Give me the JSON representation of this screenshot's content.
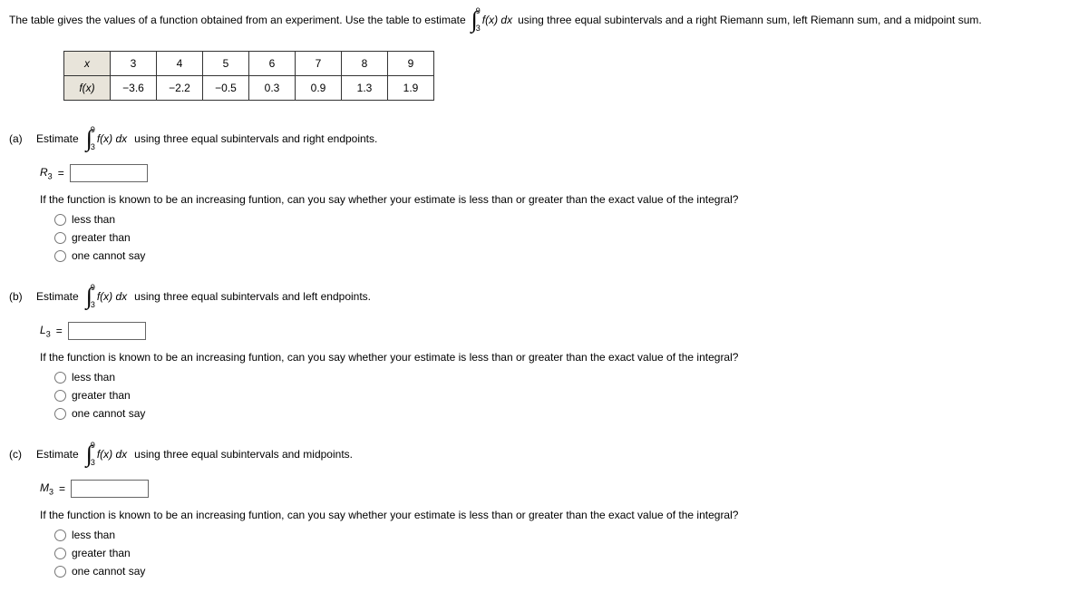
{
  "intro_pre": "The table gives the values of a function obtained from an experiment. Use the table to estimate",
  "intro_post": "using three equal subintervals and a right Riemann sum, left Riemann sum, and a midpoint sum.",
  "integral": {
    "upper": "9",
    "lower": "3",
    "integrand": "f(x) dx"
  },
  "table": {
    "head_x": "x",
    "head_fx": "f(x)",
    "x": [
      "3",
      "4",
      "5",
      "6",
      "7",
      "8",
      "9"
    ],
    "fx": [
      "−3.6",
      "−2.2",
      "−0.5",
      "0.3",
      "0.9",
      "1.3",
      "1.9"
    ]
  },
  "parts": {
    "a": {
      "label": "(a)",
      "estimate_word": "Estimate",
      "tail": "using three equal subintervals and right endpoints.",
      "sym_letter": "R",
      "sym_sub": "3",
      "eq": " = ",
      "question": "If the function is known to be an increasing funtion, can you say whether your estimate is less than or greater than the exact value of the integral?",
      "opts": [
        "less than",
        "greater than",
        "one cannot say"
      ]
    },
    "b": {
      "label": "(b)",
      "estimate_word": "Estimate",
      "tail": "using three equal subintervals and left endpoints.",
      "sym_letter": "L",
      "sym_sub": "3",
      "eq": " = ",
      "question": "If the function is known to be an increasing funtion, can you say whether your estimate is less than or greater than the exact value of the integral?",
      "opts": [
        "less than",
        "greater than",
        "one cannot say"
      ]
    },
    "c": {
      "label": "(c)",
      "estimate_word": "Estimate",
      "tail": "using three equal subintervals and midpoints.",
      "sym_letter": "M",
      "sym_sub": "3",
      "eq": " = ",
      "question": "If the function is known to be an increasing funtion, can you say whether your estimate is less than or greater than the exact value of the integral?",
      "opts": [
        "less than",
        "greater than",
        "one cannot say"
      ]
    }
  }
}
